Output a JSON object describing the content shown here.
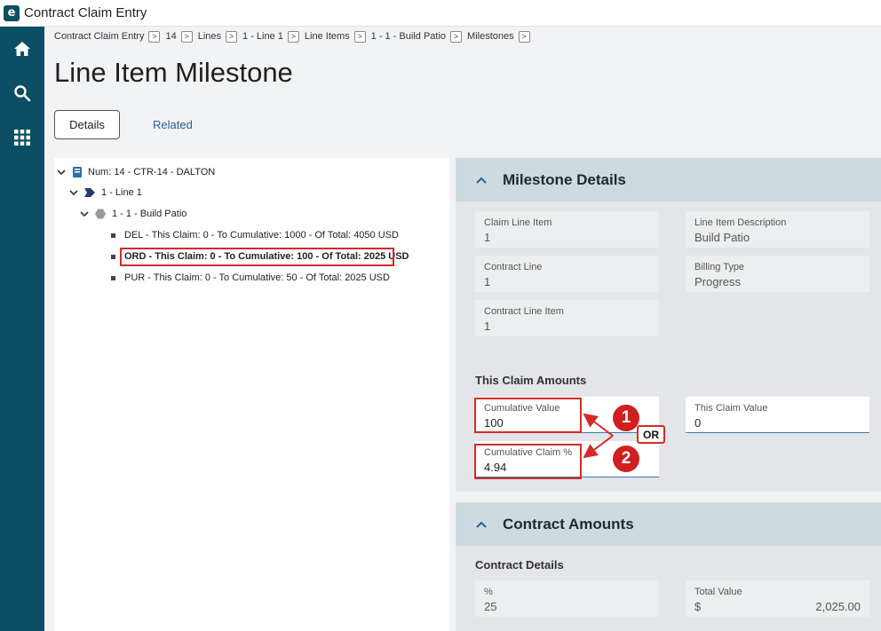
{
  "window": {
    "title": "Contract Claim Entry"
  },
  "rail": {
    "items": [
      "home-icon",
      "search-icon",
      "apps-grid-icon"
    ]
  },
  "breadcrumb": [
    "Contract Claim Entry",
    "14",
    "Lines",
    "1 - Line 1",
    "Line Items",
    "1 - 1 - Build Patio",
    "Milestones"
  ],
  "breadcrumb_arrow": ">",
  "page": {
    "title": "Line Item Milestone"
  },
  "tabs": {
    "details": "Details",
    "related": "Related"
  },
  "tree": {
    "root": "Num: 14 - CTR-14 - DALTON",
    "line": "1 - Line 1",
    "item": "1 - 1 - Build Patio",
    "milestones": [
      "DEL - This Claim: 0 - To Cumulative: 1000 - Of Total: 4050 USD",
      "ORD - This Claim: 0 - To Cumulative: 100 - Of Total: 2025 USD",
      "PUR - This Claim: 0 - To Cumulative: 50 - Of Total: 2025 USD"
    ]
  },
  "milestone_details": {
    "title": "Milestone Details",
    "claim_line_item": {
      "label": "Claim Line Item",
      "value": "1"
    },
    "line_item_description": {
      "label": "Line Item Description",
      "value": "Build Patio"
    },
    "contract_line": {
      "label": "Contract Line",
      "value": "1"
    },
    "billing_type": {
      "label": "Billing Type",
      "value": "Progress"
    },
    "contract_line_item": {
      "label": "Contract Line Item",
      "value": "1"
    }
  },
  "this_claim_amounts": {
    "heading": "This Claim Amounts",
    "cumulative_value": {
      "label": "Cumulative Value",
      "value": "100"
    },
    "this_claim_value": {
      "label": "This Claim Value",
      "value": "0"
    },
    "cumulative_claim_pct": {
      "label": "Cumulative Claim %",
      "value": "4.94"
    }
  },
  "annotations": {
    "badge_1": "1",
    "badge_2": "2",
    "or": "OR",
    "color": "#d62a2a"
  },
  "contract_amounts": {
    "title": "Contract Amounts",
    "subheading": "Contract Details",
    "pct": {
      "label": "%",
      "value": "25"
    },
    "total_value": {
      "label": "Total Value",
      "currency": "$",
      "value": "2,025.00"
    }
  },
  "colors": {
    "rail": "#0c4e63",
    "section_header": "#cddae0",
    "link": "#2b5f93",
    "highlight": "#d62a2a"
  }
}
